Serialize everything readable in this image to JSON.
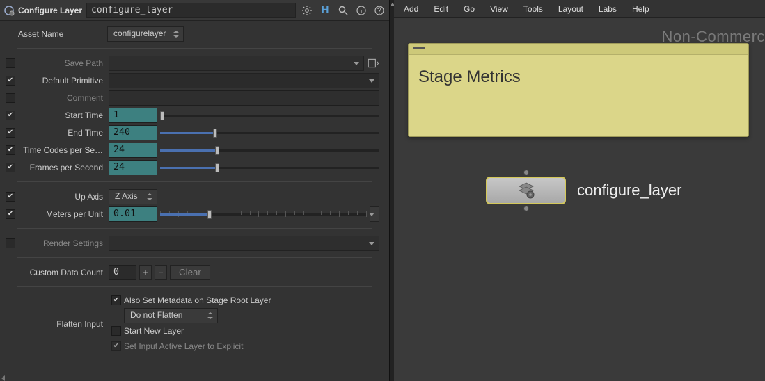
{
  "header": {
    "title": "Configure Layer",
    "node_name": "configure_layer"
  },
  "params": {
    "asset_name": {
      "label": "Asset Name",
      "value": "configurelayer"
    },
    "save_path": {
      "label": "Save Path",
      "value": ""
    },
    "default_primitive": {
      "label": "Default Primitive",
      "value": ""
    },
    "comment": {
      "label": "Comment",
      "value": ""
    },
    "start_time": {
      "label": "Start Time",
      "value": "1"
    },
    "end_time": {
      "label": "End Time",
      "value": "240"
    },
    "tcps": {
      "label": "Time Codes per Se…",
      "value": "24"
    },
    "fps": {
      "label": "Frames per Second",
      "value": "24"
    },
    "up_axis": {
      "label": "Up Axis",
      "value": "Z Axis"
    },
    "mpu": {
      "label": "Meters per Unit",
      "value": "0.01"
    },
    "render_settings": {
      "label": "Render Settings",
      "value": ""
    },
    "custom_data": {
      "label": "Custom Data Count",
      "value": "0",
      "clear": "Clear"
    },
    "flatten_input": {
      "label": "Flatten Input",
      "value": "Do not Flatten"
    },
    "sub": {
      "also_set_meta": "Also Set Metadata on Stage Root Layer",
      "start_new_layer": "Start New Layer",
      "set_input_active": "Set Input Active Layer to Explicit"
    }
  },
  "right": {
    "menu": [
      "Add",
      "Edit",
      "Go",
      "View",
      "Tools",
      "Layout",
      "Labs",
      "Help"
    ],
    "watermark": "Non-Commerc",
    "sticky_title": "Stage Metrics",
    "node_label": "configure_layer"
  }
}
